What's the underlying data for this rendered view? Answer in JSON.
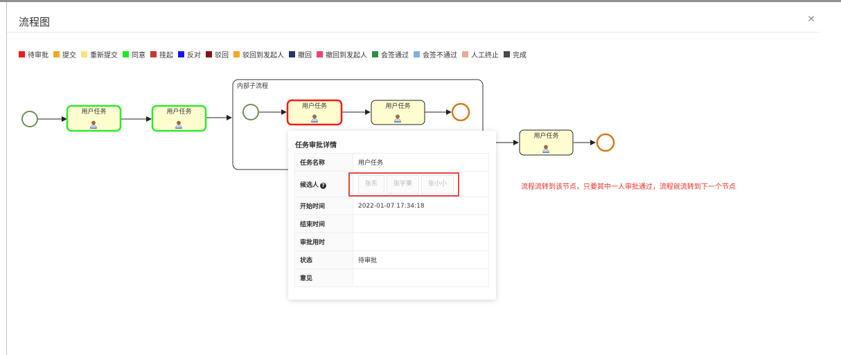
{
  "dialog": {
    "title": "流程图",
    "close_icon": "close-icon"
  },
  "legend": [
    {
      "label": "待审批",
      "color": "#ef1c1c"
    },
    {
      "label": "提交",
      "color": "#f5a623"
    },
    {
      "label": "重新提交",
      "color": "#f8e27c"
    },
    {
      "label": "同意",
      "color": "#1ee825"
    },
    {
      "label": "挂起",
      "color": "#c0392b"
    },
    {
      "label": "反对",
      "color": "#1414ef"
    },
    {
      "label": "驳回",
      "color": "#8b0f12"
    },
    {
      "label": "驳回到发起人",
      "color": "#f5a623"
    },
    {
      "label": "撤回",
      "color": "#1d3a5f"
    },
    {
      "label": "撤回到发起人",
      "color": "#e8457a"
    },
    {
      "label": "会签通过",
      "color": "#2e8b45"
    },
    {
      "label": "会签不通过",
      "color": "#7fb1d9"
    },
    {
      "label": "人工终止",
      "color": "#e6ad92"
    },
    {
      "label": "完成",
      "color": "#4a4a4a"
    }
  ],
  "diagram": {
    "nodes": [
      {
        "label": "用户任务",
        "status": "同意",
        "icon": "user-icon"
      },
      {
        "label": "用户任务",
        "status": "同意",
        "icon": "user-icon"
      },
      {
        "label": "用户任务",
        "status": "待审批",
        "icon": "user-icon"
      },
      {
        "label": "用户任务",
        "status": "",
        "icon": "user-icon"
      },
      {
        "label": "用户任务",
        "status": "",
        "icon": "user-icon"
      }
    ],
    "subprocess_label": "内部子流程"
  },
  "popup": {
    "title": "任务审批详情",
    "rows": {
      "task_name": {
        "label": "任务名称",
        "value": "用户任务"
      },
      "candidates": {
        "label": "候选人",
        "values": [
          "张东",
          "张宇果",
          "张小小"
        ],
        "help_icon": "help-icon"
      },
      "start_time": {
        "label": "开始时间",
        "value": "2022-01-07 17:34:18"
      },
      "end_time": {
        "label": "结束时间",
        "value": ""
      },
      "duration": {
        "label": "审批用时",
        "value": ""
      },
      "status": {
        "label": "状态",
        "value": "待审批"
      },
      "opinion": {
        "label": "意见",
        "value": ""
      }
    }
  },
  "annotation": "流程流转到该节点，只要其中一人审批通过，流程就流转到下一个节点"
}
